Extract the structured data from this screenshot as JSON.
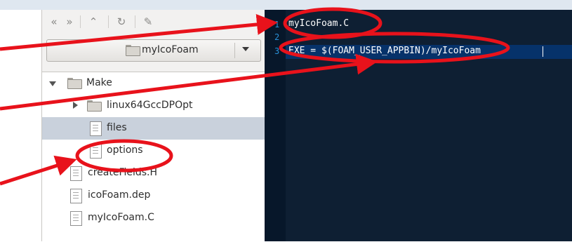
{
  "toolbar": {
    "icons": [
      "back-icon",
      "forward-icon",
      "up-icon",
      "reload-icon",
      "toggle-path-icon"
    ]
  },
  "location": {
    "folder_name": "myIcoFoam"
  },
  "tree": [
    {
      "label": "Make",
      "type": "folder",
      "expanded": true
    },
    {
      "label": "linux64GccDPOpt",
      "type": "folder",
      "expanded": false
    },
    {
      "label": "files",
      "type": "file",
      "selected": true
    },
    {
      "label": "options",
      "type": "file"
    },
    {
      "label": "createFields.H",
      "type": "file"
    },
    {
      "label": "icoFoam.dep",
      "type": "file"
    },
    {
      "label": "myIcoFoam.C",
      "type": "file"
    }
  ],
  "editor": {
    "line_numbers": [
      "1",
      "2",
      "3"
    ],
    "lines": [
      "myIcoFoam.C",
      "",
      "EXE = $(FOAM_USER_APPBIN)/myIcoFoam"
    ]
  },
  "annotations": {
    "color": "#e8121b"
  }
}
